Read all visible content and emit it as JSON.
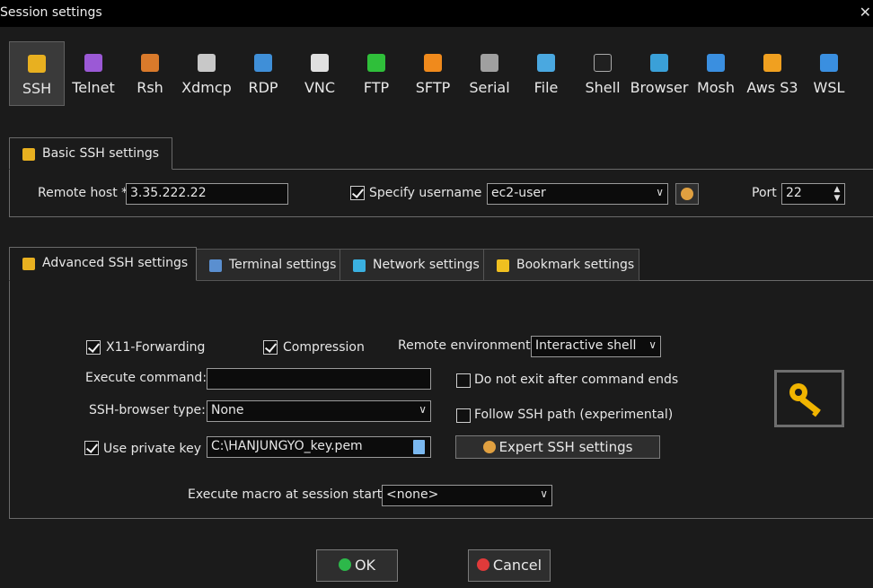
{
  "window": {
    "title": "Session settings",
    "close_glyph": "✕"
  },
  "protocols": [
    {
      "label": "SSH",
      "icon": "ssh-key-icon",
      "color": "#e8b020",
      "selected": true
    },
    {
      "label": "Telnet",
      "icon": "telnet-icon",
      "color": "#9b59d6"
    },
    {
      "label": "Rsh",
      "icon": "rsh-icon",
      "color": "#d97a2b"
    },
    {
      "label": "Xdmcp",
      "icon": "xdmcp-icon",
      "color": "#c8c8c8"
    },
    {
      "label": "RDP",
      "icon": "rdp-icon",
      "color": "#3f8fd8"
    },
    {
      "label": "VNC",
      "icon": "vnc-icon",
      "color": "#e0e0e0"
    },
    {
      "label": "FTP",
      "icon": "ftp-icon",
      "color": "#2fbf3a"
    },
    {
      "label": "SFTP",
      "icon": "sftp-icon",
      "color": "#f08a1c"
    },
    {
      "label": "Serial",
      "icon": "serial-icon",
      "color": "#a0a0a0"
    },
    {
      "label": "File",
      "icon": "file-icon",
      "color": "#4aa8e0"
    },
    {
      "label": "Shell",
      "icon": "shell-icon",
      "color": "#202020"
    },
    {
      "label": "Browser",
      "icon": "browser-icon",
      "color": "#3aa0d8"
    },
    {
      "label": "Mosh",
      "icon": "mosh-icon",
      "color": "#3a8fe0"
    },
    {
      "label": "Aws S3",
      "icon": "aws-s3-icon",
      "color": "#f0a020"
    },
    {
      "label": "WSL",
      "icon": "wsl-icon",
      "color": "#3a8fe0"
    }
  ],
  "basic": {
    "tab_label": "Basic SSH settings",
    "remote_host_label": "Remote host *",
    "remote_host_value": "3.35.222.22",
    "specify_username_label": "Specify username",
    "specify_username_checked": true,
    "username_value": "ec2-user",
    "port_label": "Port",
    "port_value": "22"
  },
  "tabs": [
    {
      "label": "Advanced SSH settings",
      "icon": "ssh-key-icon",
      "active": true
    },
    {
      "label": "Terminal settings",
      "icon": "terminal-icon"
    },
    {
      "label": "Network settings",
      "icon": "network-icon"
    },
    {
      "label": "Bookmark settings",
      "icon": "star-icon"
    }
  ],
  "advanced": {
    "x11_label": "X11-Forwarding",
    "x11_checked": true,
    "compression_label": "Compression",
    "compression_checked": true,
    "remote_env_label": "Remote environment:",
    "remote_env_value": "Interactive shell",
    "execute_command_label": "Execute command:",
    "execute_command_value": "",
    "do_not_exit_label": "Do not exit after command ends",
    "do_not_exit_checked": false,
    "ssh_browser_label": "SSH-browser type:",
    "ssh_browser_value": "None",
    "follow_path_label": "Follow SSH path (experimental)",
    "follow_path_checked": false,
    "use_private_key_label": "Use private key",
    "use_private_key_checked": true,
    "private_key_value": "C:\\HANJUNGYO_key.pem",
    "expert_button_label": "Expert SSH settings",
    "macro_label": "Execute macro at session start:",
    "macro_value": "<none>"
  },
  "footer": {
    "ok_label": "OK",
    "cancel_label": "Cancel"
  },
  "colors": {
    "accent_ok": "#2db84a",
    "accent_cancel": "#e03a3a",
    "key_gold": "#f0b400"
  }
}
